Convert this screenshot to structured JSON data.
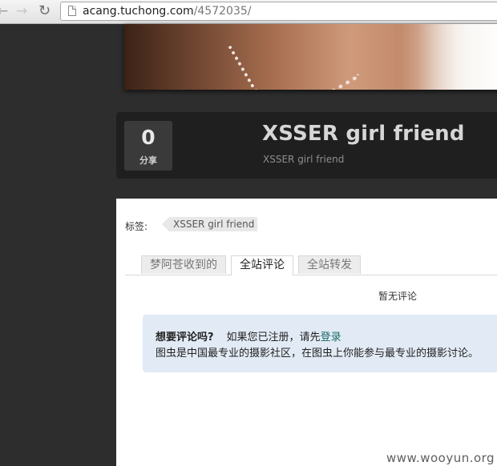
{
  "browser": {
    "back_icon": "back-arrow-icon",
    "forward_icon": "forward-arrow-icon",
    "reload_icon": "reload-icon",
    "url_host": "acang.tuchong.com",
    "url_path": "/4572035/"
  },
  "photo": {
    "share_count": "0",
    "share_label": "分享",
    "title": "XSSER girl friend",
    "subtitle": "XSSER girl friend"
  },
  "tags": {
    "label": "标签:",
    "items": [
      "XSSER girl friend"
    ]
  },
  "tabs": [
    {
      "label": "梦阿苍收到的",
      "active": false
    },
    {
      "label": "全站评论",
      "active": true
    },
    {
      "label": "全站转发",
      "active": false
    }
  ],
  "comments": {
    "empty_text": "暂无评论"
  },
  "notice": {
    "question": "想要评论吗?",
    "prefix": "如果您已注册，请先",
    "login_link": "登录",
    "line2": "图虫是中国最专业的摄影社区，在图虫上你能参与最专业的摄影讨论。"
  },
  "watermark": "www.wooyun.org",
  "colors": {
    "page_bg": "#2d2d2d",
    "infobar_bg": "#1f1f1f",
    "notice_bg": "#e2ebf5",
    "link": "#1a6a6a"
  }
}
